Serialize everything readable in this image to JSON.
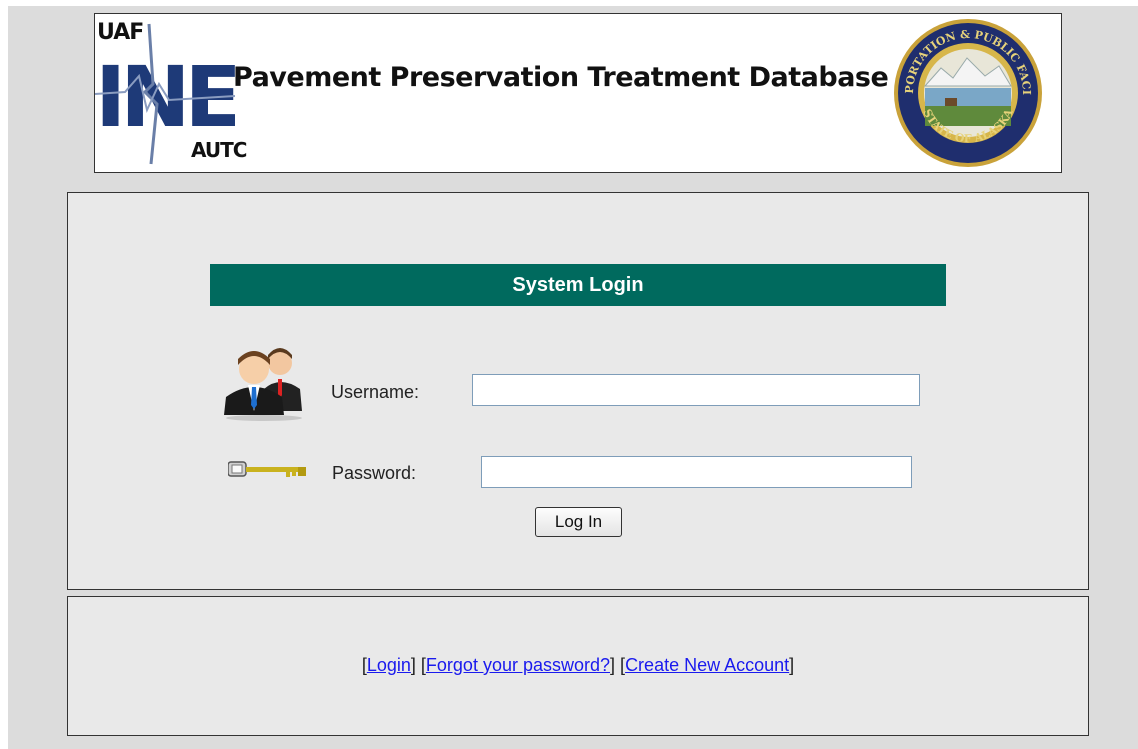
{
  "banner": {
    "logo_top": "UAF",
    "logo_bottom": "AUTC",
    "title": "Pavement Preservation Treatment Database",
    "seal_text_top": "TRANSPORTATION & PUBLIC FACILITIES",
    "seal_text_bottom": "STATE OF ALASKA"
  },
  "login": {
    "header": "System Login",
    "username_label": "Username:",
    "username_value": "",
    "password_label": "Password:",
    "password_value": "",
    "submit_label": "Log In"
  },
  "links": {
    "open_bracket": "[",
    "close_bracket": "]",
    "login": "Login",
    "forgot": "Forgot your password?",
    "create": "Create New Account"
  },
  "colors": {
    "header_bg": "#006a5e",
    "link": "#1a1aee",
    "panel_bg": "#e9e9e9"
  },
  "icons": [
    "ine-logo-icon",
    "alaska-seal-icon",
    "users-icon",
    "key-icon"
  ]
}
